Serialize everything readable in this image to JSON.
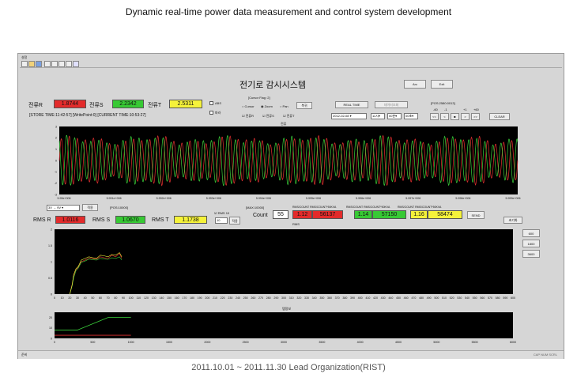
{
  "caption_top": "Dynamic real-time power data measurement and control system development",
  "caption_bottom": "2011.10.01 ~ 2011.11.30 Lead Organization(RIST)",
  "window": {
    "menu_item": "설정",
    "title": "전기로 감시시스템",
    "arc_button": "Arc",
    "exit_button": "Exit",
    "status_bar_left": "준비",
    "status_bar_right": "CAP NUM SCRL"
  },
  "currents": [
    {
      "label": "전류R",
      "value": "1.8744",
      "color": "#e32b2b"
    },
    {
      "label": "전류S",
      "value": "2.2342",
      "color": "#37c934"
    },
    {
      "label": "전류T",
      "value": "2.5311",
      "color": "#f5f23a"
    }
  ],
  "status_line": "[STORE TIME:11:42:57]  [WritePoint:0]  [CURRENT TIME:10:53:27]",
  "options": {
    "abs": "ABS",
    "second_opt": "파라",
    "cursor_flag": "[Cursor Flag :2]",
    "cursor": "Cursor",
    "zoom": "Zoom",
    "pan": "Pan",
    "restore": "복귀",
    "ch_r": "전류R",
    "ch_s": "전류S",
    "ch_t": "전류T"
  },
  "controls": {
    "real_time": "REAL TIME",
    "data_query": "데이터조회",
    "pos_top": "[POS:2580:0013]",
    "date": "2012-02-08",
    "hour": "11시",
    "min": "00분",
    "sec": "00초",
    "offsets": [
      "-60",
      "-1",
      "+1",
      "+60"
    ],
    "nav": [
      "<<",
      "<",
      "■",
      ">",
      ">>"
    ],
    "clear": "CLEAR"
  },
  "wave_chart": {
    "title": "전류",
    "y_ticks": [
      "3",
      "2",
      "1",
      "0",
      "-1",
      "-2",
      "-3"
    ],
    "x_ticks": [
      "5.99e+006",
      "5.991e+006",
      "5.992e+006",
      "5.993e+006",
      "5.994e+006",
      "5.995e+006",
      "5.996e+006",
      "5.997e+006",
      "5.998e+006",
      "5.999e+006"
    ]
  },
  "mid_row": {
    "select_value": "3V → 9V",
    "apply": "적용",
    "pos": "[POS:10000]",
    "max": "[MAX:10000]",
    "rms_header_1": "RMS/COUNT  RMS/COUNT*50KVA",
    "rms_header_2": "RMS/COUNT  RMS/COUNT*50KVA",
    "rms_header_3": "RMS/COUNT  RMS/COUNT*50KVA"
  },
  "rms": [
    {
      "label": "RMS R",
      "value": "1.0116",
      "color": "#e32b2b"
    },
    {
      "label": "RMS S",
      "value": "1.0670",
      "color": "#37c934"
    },
    {
      "label": "RMS T",
      "value": "1.1738",
      "color": "#f5f23a"
    }
  ],
  "rms_options": {
    "rms_label": "RMS 10",
    "rms_value": "10",
    "apply": "적용"
  },
  "count": {
    "label": "Count",
    "value": "55"
  },
  "rms_counts": [
    {
      "a": "1.12",
      "b": "56137",
      "color": "#e32b2b"
    },
    {
      "a": "1.14",
      "b": "57150",
      "color": "#37c934"
    },
    {
      "a": "1.16",
      "b": "58474",
      "color": "#f5f23a"
    }
  ],
  "send": "SEND",
  "init": "초기화",
  "side_buttons": [
    "600",
    "1800",
    "3600"
  ],
  "rms_chart": {
    "title": "RMS",
    "y_ticks": [
      "2",
      "1.5",
      "1",
      "0.5",
      "0"
    ],
    "x_ticks": [
      "0",
      "10",
      "20",
      "30",
      "40",
      "50",
      "60",
      "70",
      "80",
      "90",
      "100",
      "110",
      "120",
      "130",
      "140",
      "150",
      "160",
      "170",
      "180",
      "190",
      "200",
      "210",
      "220",
      "230",
      "240",
      "250",
      "260",
      "270",
      "280",
      "290",
      "300",
      "310",
      "320",
      "330",
      "340",
      "350",
      "360",
      "370",
      "380",
      "390",
      "400",
      "410",
      "420",
      "430",
      "440",
      "450",
      "460",
      "470",
      "480",
      "490",
      "500",
      "510",
      "520",
      "530",
      "540",
      "550",
      "560",
      "570",
      "580",
      "590",
      "600"
    ]
  },
  "step_chart": {
    "title": "탭정보",
    "y_ticks": [
      "20",
      "10",
      "0"
    ],
    "x_ticks": [
      "0",
      "500",
      "1000",
      "1500",
      "2000",
      "2500",
      "3000",
      "3500",
      "4000",
      "4500",
      "5000",
      "5500",
      "6000"
    ]
  },
  "chart_data": [
    {
      "type": "line",
      "title": "전류",
      "xlabel": "",
      "ylabel": "",
      "xlim": [
        5990000,
        5999000
      ],
      "ylim": [
        -3,
        3
      ],
      "grid": false,
      "series": [
        {
          "color": "#e53030",
          "amplitude": 2.0,
          "cycles": 57
        },
        {
          "color": "#3bd23b",
          "amplitude": 2.0,
          "cycles": 57
        }
      ]
    },
    {
      "type": "line",
      "title": "RMS",
      "xlabel": "",
      "ylabel": "",
      "xlim": [
        0,
        600
      ],
      "ylim": [
        0,
        2
      ],
      "grid": false,
      "x": [
        20,
        23,
        25,
        28,
        31,
        35,
        40,
        45,
        50,
        55,
        60,
        65,
        70,
        75,
        80,
        85,
        88
      ],
      "series": [
        {
          "color": "#e53030",
          "values": [
            0.0,
            0.3,
            0.55,
            0.75,
            0.82,
            1.0,
            1.05,
            1.1,
            1.1,
            1.08,
            1.15,
            1.12,
            1.1,
            1.2,
            1.15,
            1.25,
            1.1
          ]
        },
        {
          "color": "#3bd23b",
          "values": [
            0.0,
            0.25,
            0.5,
            0.72,
            0.8,
            0.98,
            1.02,
            1.08,
            1.06,
            1.05,
            1.1,
            1.08,
            1.07,
            1.12,
            1.1,
            1.15,
            1.05
          ]
        },
        {
          "color": "#f5f23a",
          "values": [
            0.0,
            0.28,
            0.6,
            0.78,
            0.85,
            1.05,
            1.1,
            1.15,
            1.12,
            1.1,
            1.2,
            1.18,
            1.15,
            1.22,
            1.2,
            1.28,
            1.15
          ]
        }
      ]
    },
    {
      "type": "line",
      "title": "탭정보",
      "xlabel": "",
      "ylabel": "",
      "xlim": [
        0,
        6000
      ],
      "ylim": [
        0,
        25
      ],
      "grid": false,
      "x": [
        0,
        300,
        700,
        1000
      ],
      "series": [
        {
          "color": "#3bd23b",
          "values": [
            8,
            8,
            20,
            20
          ]
        },
        {
          "color": "#e53030",
          "values": [
            3,
            3,
            3,
            3
          ]
        }
      ]
    }
  ]
}
